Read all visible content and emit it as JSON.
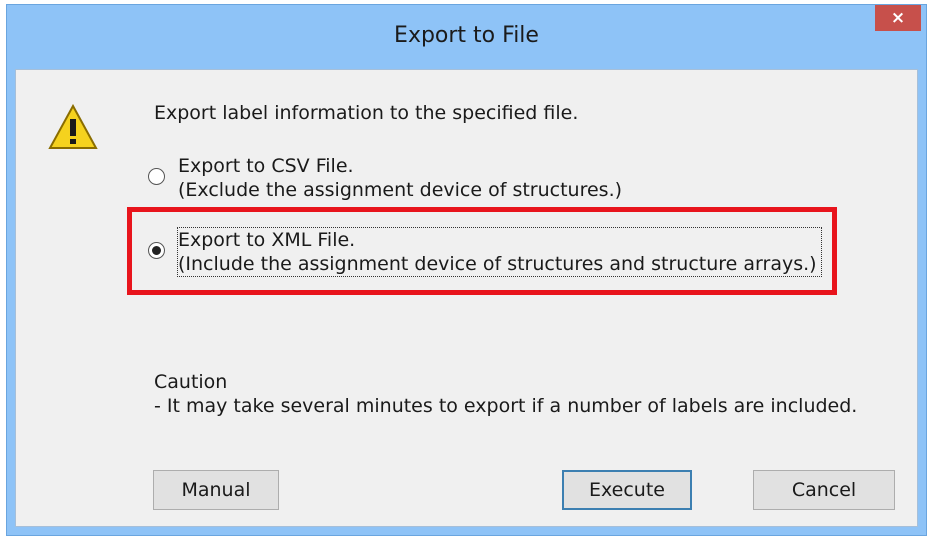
{
  "window": {
    "title": "Export to File",
    "close_glyph": "×"
  },
  "dialog": {
    "message": "Export label information to the specified file.",
    "options": [
      {
        "line1": "Export to CSV File.",
        "line2": "(Exclude the assignment device of structures.)",
        "selected": false
      },
      {
        "line1": "Export to XML File.",
        "line2": "(Include the assignment device of structures and structure arrays.)",
        "selected": true
      }
    ],
    "caution_title": "Caution",
    "caution_text": "- It may take several minutes to export if a number of labels are included."
  },
  "buttons": {
    "manual": "Manual",
    "execute": "Execute",
    "cancel": "Cancel"
  },
  "icons": {
    "warning": "warning-icon",
    "close": "close-icon"
  },
  "colors": {
    "titlebar": "#8ec3f7",
    "close": "#c7504b",
    "highlight": "#e8141c"
  }
}
